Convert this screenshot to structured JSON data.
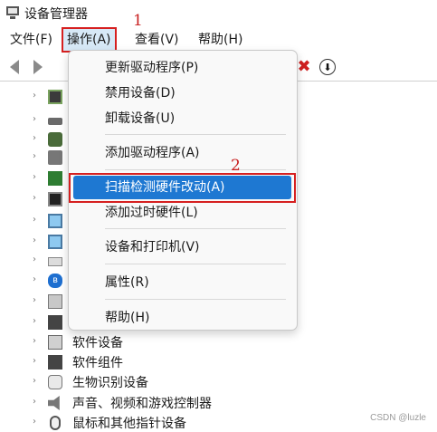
{
  "window": {
    "title": "设备管理器"
  },
  "menubar": {
    "file": "文件(F)",
    "action": "操作(A)",
    "view": "查看(V)",
    "help": "帮助(H)"
  },
  "toolbar": {
    "back_icon": "arrow-left",
    "forward_icon": "arrow-right",
    "uninstall_icon": "red-x",
    "uninstall_glyph": "✖",
    "update_icon": "down-arrow-circle",
    "update_glyph": "⬇"
  },
  "action_menu": {
    "items": [
      "更新驱动程序(P)",
      "禁用设备(D)",
      "卸载设备(U)",
      "添加驱动程序(A)",
      "扫描检测硬件改动(A)",
      "添加过时硬件(L)",
      "设备和打印机(V)",
      "属性(R)",
      "帮助(H)"
    ],
    "selected_index": 4
  },
  "tree": {
    "chevron": "›",
    "bluetooth_glyph": "ʙ",
    "visible_labels": [
      "软件设备",
      "软件组件",
      "生物识别设备",
      "声音、视频和游戏控制器",
      "鼠标和其他指针设备"
    ]
  },
  "annotations": {
    "step1": "1",
    "step2": "2"
  },
  "watermark": "CSDN @luzle",
  "colors": {
    "highlight": "#1e78d2",
    "annotation": "#d62020",
    "menu_active": "#d7e9f7"
  }
}
